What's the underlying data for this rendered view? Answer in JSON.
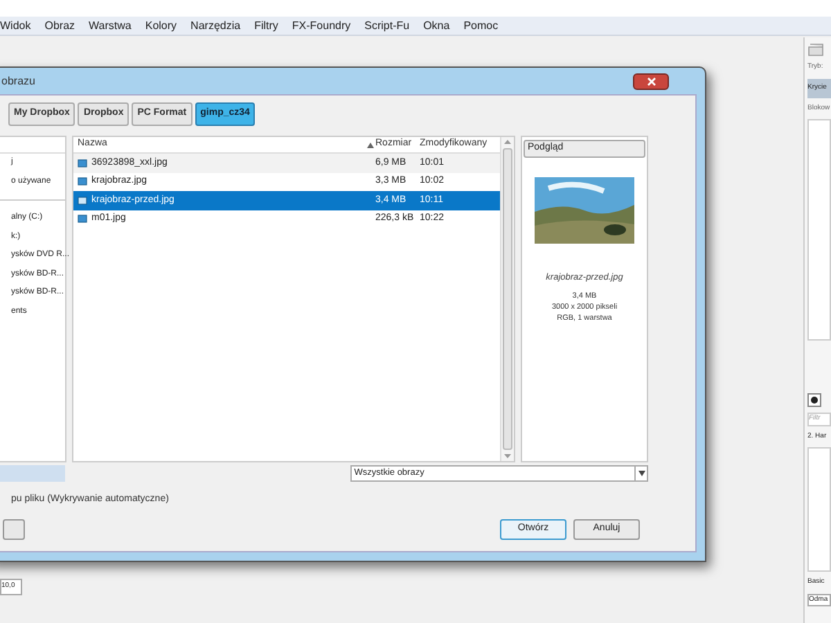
{
  "menu_bar": [
    "Widok",
    "Obraz",
    "Warstwa",
    "Kolory",
    "Narzędzia",
    "Filtry",
    "FX-Foundry",
    "Script-Fu",
    "Okna",
    "Pomoc"
  ],
  "dialog": {
    "title": "obrazu",
    "path_buttons": [
      {
        "label": "My Dropbox",
        "selected": false
      },
      {
        "label": "Dropbox",
        "selected": false
      },
      {
        "label": "PC Format",
        "selected": false
      },
      {
        "label": "gimp_cz34",
        "selected": true
      }
    ],
    "places": [
      {
        "label": "j",
        "kind": "place"
      },
      {
        "label": "o używane",
        "kind": "place"
      },
      {
        "kind": "separator"
      },
      {
        "label": "alny (C:)",
        "kind": "place"
      },
      {
        "label": "k:)",
        "kind": "place"
      },
      {
        "label": "ysków DVD R...",
        "kind": "place"
      },
      {
        "label": "ysków BD-R...",
        "kind": "place"
      },
      {
        "label": "ysków BD-R...",
        "kind": "place"
      },
      {
        "label": "ents",
        "kind": "place"
      }
    ],
    "columns": [
      "Nazwa",
      "Rozmiar",
      "Zmodyfikowany"
    ],
    "files": [
      {
        "name": "36923898_xxl.jpg",
        "size": "6,9 MB",
        "modified": "10:01",
        "selected": false
      },
      {
        "name": "krajobraz.jpg",
        "size": "3,3 MB",
        "modified": "10:02",
        "selected": false
      },
      {
        "name": "krajobraz-przed.jpg",
        "size": "3,4 MB",
        "modified": "10:11",
        "selected": true
      },
      {
        "name": "m01.jpg",
        "size": "226,3 kB",
        "modified": "10:22",
        "selected": false
      }
    ],
    "preview": {
      "header": "Podgląd",
      "filename": "krajobraz-przed.jpg",
      "info": [
        "3,4 MB",
        "3000 x 2000 pikseli",
        "RGB, 1 warstwa"
      ]
    },
    "filter": "Wszystkie obrazy",
    "file_type": "pu pliku (Wykrywanie automatyczne)",
    "buttons": [
      "Otwórz",
      "Anuluj"
    ]
  },
  "dock": {
    "mode_label": "Tryb:",
    "mode_value": "Krycie",
    "lock_label": "Blokow",
    "filter_placeholder": "Filtr",
    "brush_label": "2. Har",
    "preset": "Basic",
    "preset_value": "Odma"
  },
  "spinner_value": "10,0"
}
